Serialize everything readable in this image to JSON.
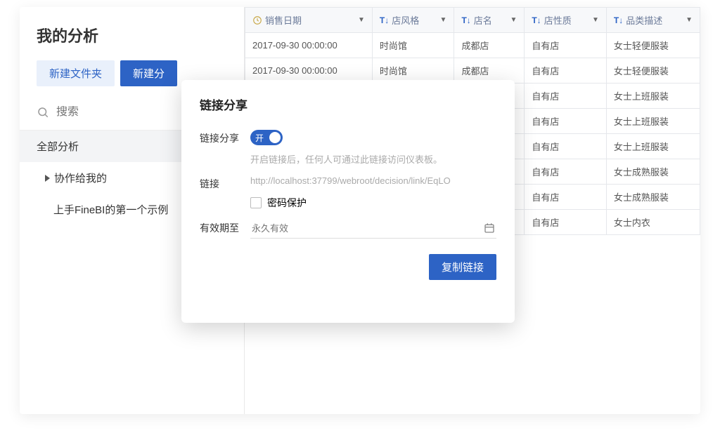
{
  "sidebar": {
    "title": "我的分析",
    "btn_new_folder": "新建文件夹",
    "btn_new_analysis": "新建分",
    "search_placeholder": "搜索",
    "nav_all": "全部分析",
    "nav_shared": "协作给我的",
    "nav_sample": "上手FineBI的第一个示例"
  },
  "table": {
    "headers": [
      "销售日期",
      "店风格",
      "店名",
      "店性质",
      "品类描述"
    ],
    "rows": [
      [
        "2017-09-30 00:00:00",
        "时尚馆",
        "成都店",
        "自有店",
        "女士轻便服装"
      ],
      [
        "2017-09-30 00:00:00",
        "时尚馆",
        "成都店",
        "自有店",
        "女士轻便服装"
      ],
      [
        "",
        "",
        "",
        "自有店",
        "女士上班服装"
      ],
      [
        "",
        "",
        "",
        "自有店",
        "女士上班服装"
      ],
      [
        "",
        "",
        "",
        "自有店",
        "女士上班服装"
      ],
      [
        "",
        "",
        "",
        "自有店",
        "女士成熟服装"
      ],
      [
        "",
        "",
        "",
        "自有店",
        "女士成熟服装"
      ],
      [
        "",
        "",
        "",
        "自有店",
        "女士内衣"
      ]
    ]
  },
  "modal": {
    "title": "链接分享",
    "label_share": "链接分享",
    "toggle_on": "开",
    "hint": "开启链接后，任何人可通过此链接访问仪表板。",
    "label_link": "链接",
    "url": "http://localhost:37799/webroot/decision/link/EqLO",
    "label_password": "密码保护",
    "label_expire": "有效期至",
    "expire_placeholder": "永久有效",
    "btn_copy": "复制链接"
  }
}
